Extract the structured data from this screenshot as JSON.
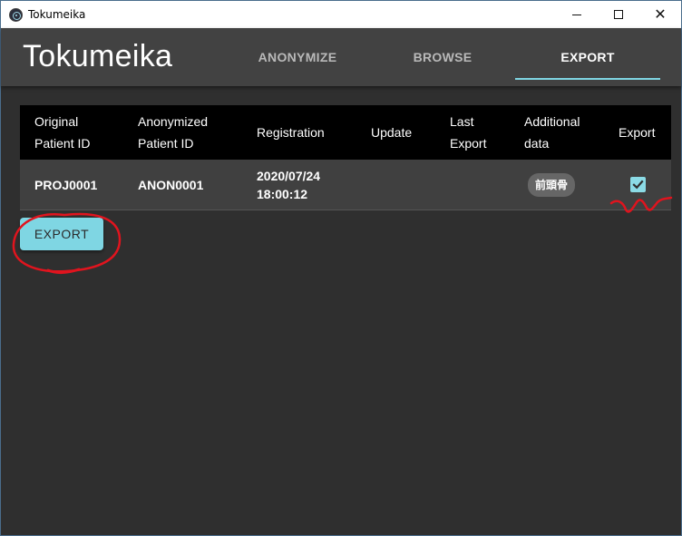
{
  "window": {
    "title": "Tokumeika",
    "minimize_icon": "minimize-icon",
    "maximize_icon": "maximize-icon",
    "close_glyph": "✕"
  },
  "appbar": {
    "brand": "Tokumeika",
    "tabs": [
      {
        "label": "ANONYMIZE",
        "active": false
      },
      {
        "label": "BROWSE",
        "active": false
      },
      {
        "label": "EXPORT",
        "active": true
      }
    ]
  },
  "table": {
    "headers": {
      "original_line1": "Original",
      "original_line2": "Patient ID",
      "anonymized_line1": "Anonymized",
      "anonymized_line2": "Patient ID",
      "registration": "Registration",
      "update": "Update",
      "last_export_line1": "Last",
      "last_export_line2": "Export",
      "additional_line1": "Additional",
      "additional_line2": "data",
      "export": "Export"
    },
    "rows": [
      {
        "original_id": "PROJ0001",
        "anonymized_id": "ANON0001",
        "registration_date": "2020/07/24",
        "registration_time": "18:00:12",
        "update": "",
        "last_export": "",
        "additional_chip": "前頭骨",
        "export_checked": true
      }
    ]
  },
  "actions": {
    "export_label": "EXPORT"
  },
  "colors": {
    "accent": "#7fd6e3",
    "background": "#2f2f2f",
    "appbar": "#424242",
    "annotation": "#e0141e"
  }
}
